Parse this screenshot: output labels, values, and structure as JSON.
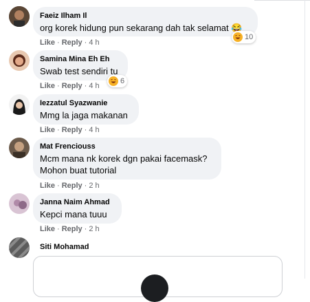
{
  "comments": [
    {
      "name": "Faeiz Ilham Il",
      "lines": [
        "org korek hidung pun sekarang dah tak selamat 😂"
      ],
      "like": "Like",
      "reply": "Reply",
      "time": "4 h",
      "reaction_count": "10"
    },
    {
      "name": "Samina Mina Eh Eh",
      "lines": [
        "Swab test sendiri tu"
      ],
      "like": "Like",
      "reply": "Reply",
      "time": "4 h",
      "reaction_count": "6"
    },
    {
      "name": "Iezzatul Syazwanie",
      "lines": [
        "Mmg la jaga makanan"
      ],
      "like": "Like",
      "reply": "Reply",
      "time": "4 h"
    },
    {
      "name": "Mat Frenciouss",
      "lines": [
        "Mcm mana nk korek dgn pakai facemask?",
        "Mohon buat tutorial"
      ],
      "like": "Like",
      "reply": "Reply",
      "time": "2 h"
    },
    {
      "name": "Janna Naim Ahmad",
      "lines": [
        "Kepci mana tuuu"
      ],
      "like": "Like",
      "reply": "Reply",
      "time": "2 h"
    },
    {
      "name": "Siti Mohamad"
    }
  ],
  "separator": "·",
  "colors": {
    "bubble": "#f0f2f5",
    "meta": "#65676b",
    "text": "#050505"
  }
}
